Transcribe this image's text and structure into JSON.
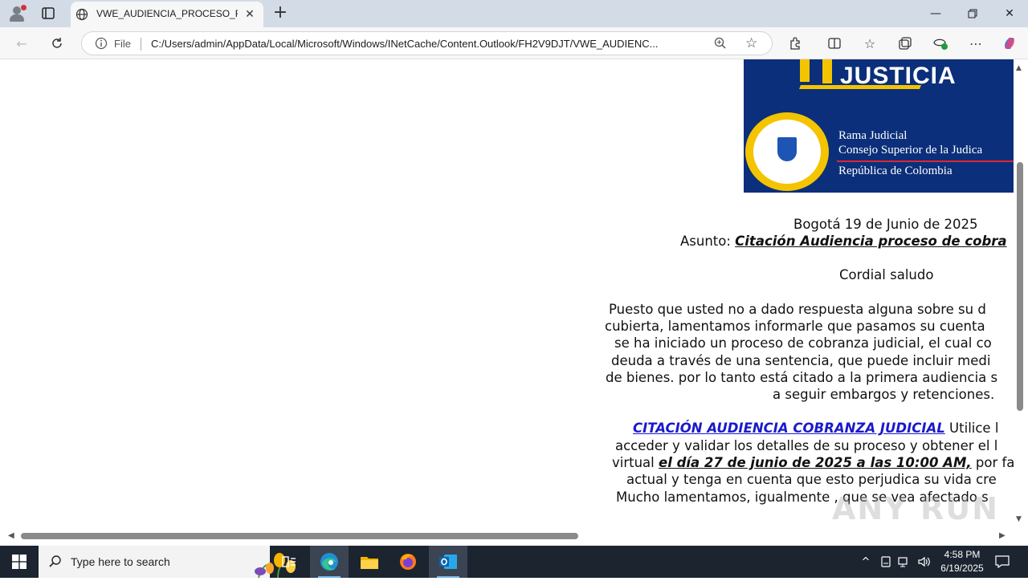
{
  "browser": {
    "tab_title": "VWE_AUDIENCIA_PROCESO_REF",
    "address_scheme": "File",
    "url": "C:/Users/admin/AppData/Local/Microsoft/Windows/INetCache/Content.Outlook/FH2V9DJT/VWE_AUDIENC..."
  },
  "banner": {
    "title": "JUSTICIA",
    "line1": "Rama Judicial",
    "line2": "Consejo Superior de la Judica",
    "line3": "República de Colombia"
  },
  "letter": {
    "date": "Bogotá 19 de Junio de 2025",
    "subject_label": "Asunto: ",
    "subject": "Citación Audiencia proceso de cobra",
    "greeting": "Cordial saludo",
    "para1_l1": "Puesto que usted no a dado respuesta alguna sobre su d",
    "para1_l2": "cubierta, lamentamos informarle que pasamos su cuenta",
    "para1_l3": "se ha iniciado un proceso de cobranza judicial, el cual co",
    "para1_l4": "deuda a través de una sentencia, que puede incluir medi",
    "para1_l5": "de bienes. por lo tanto está citado a la primera audiencia s",
    "para1_l6": "a seguir embargos y retenciones.",
    "link_text": "CITACIÓN AUDIENCIA COBRANZA JUDICIAL",
    "para2_l1_rest": " Utilice l",
    "para2_l2": "acceder y validar los detalles de su proceso y obtener el l",
    "para2_l3_pre": "virtual ",
    "para2_l3_date": "el día 27 de junio de 2025 a las 10:00 AM,",
    "para2_l3_post": " por fav",
    "para2_l4": "actual y tenga en cuenta que esto perjudica su vida cre",
    "para2_l5": "Mucho lamentamos, igualmente , que se vea afectado s"
  },
  "watermark": "ANY RUN",
  "taskbar": {
    "search_placeholder": "Type here to search",
    "time": "4:58 PM",
    "date": "6/19/2025"
  },
  "colors": {
    "accent": "#0b2f7a",
    "link": "#1a1acc",
    "taskbar": "#1c2430"
  }
}
